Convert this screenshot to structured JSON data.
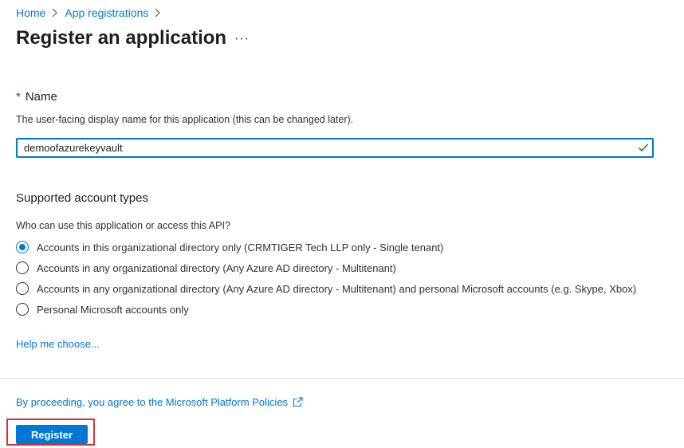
{
  "breadcrumb": {
    "home": "Home",
    "app_registrations": "App registrations"
  },
  "page": {
    "title": "Register an application",
    "more": "···"
  },
  "name_section": {
    "required_mark": "*",
    "label": "Name",
    "description": "The user-facing display name for this application (this can be changed later).",
    "value": "demoofazurekeyvault"
  },
  "account_types": {
    "label": "Supported account types",
    "question": "Who can use this application or access this API?",
    "options": [
      {
        "label": "Accounts in this organizational directory only (CRMTIGER Tech LLP only - Single tenant)",
        "selected": true
      },
      {
        "label": "Accounts in any organizational directory (Any Azure AD directory - Multitenant)",
        "selected": false
      },
      {
        "label": "Accounts in any organizational directory (Any Azure AD directory - Multitenant) and personal Microsoft accounts (e.g. Skype, Xbox)",
        "selected": false
      },
      {
        "label": "Personal Microsoft accounts only",
        "selected": false
      }
    ],
    "help_link": "Help me choose..."
  },
  "footer": {
    "policy_text": "By proceeding, you agree to the Microsoft Platform Policies",
    "register_label": "Register"
  },
  "colors": {
    "accent": "#0078d4",
    "highlight": "#d13438",
    "required": "#a4262c",
    "valid": "#107c10"
  }
}
